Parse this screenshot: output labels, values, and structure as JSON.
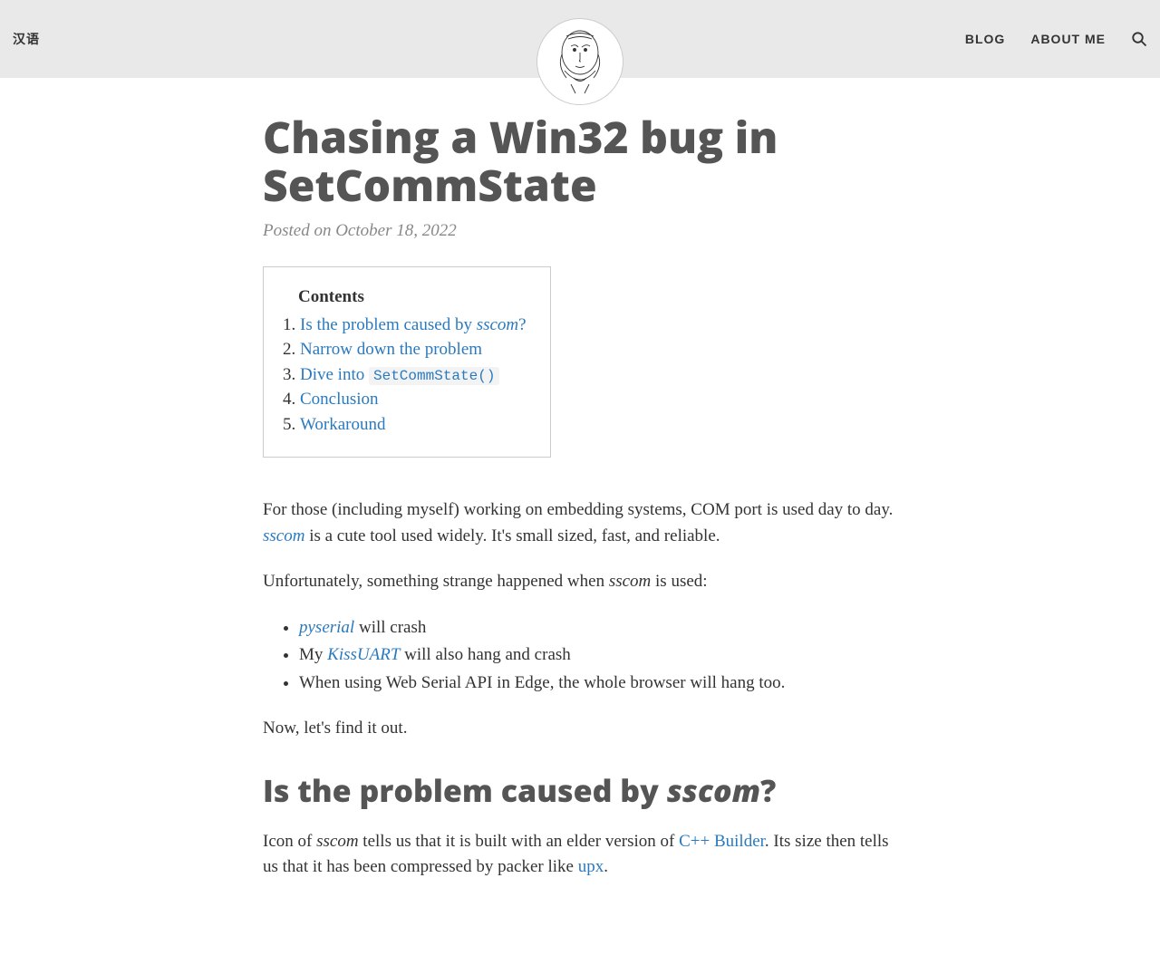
{
  "header": {
    "lang": "汉语",
    "nav": {
      "blog": "BLOG",
      "about": "ABOUT ME"
    }
  },
  "title": "Chasing a Win32 bug in SetCommState",
  "meta": "Posted on October 18, 2022",
  "toc": {
    "title": "Contents",
    "items": [
      {
        "text": "Is the problem caused by ",
        "em": "sscom",
        "tail": "?"
      },
      {
        "text": "Narrow down the problem"
      },
      {
        "text": "Dive into ",
        "code": "SetCommState()"
      },
      {
        "text": "Conclusion"
      },
      {
        "text": "Workaround"
      }
    ]
  },
  "p1": {
    "a": "For those (including myself) working on embedding systems, COM port is used day to day. ",
    "link": "sscom",
    "b": " is a cute tool used widely. It's small sized, fast, and reliable."
  },
  "p2": {
    "a": "Unfortunately, something strange happened when ",
    "em": "sscom",
    "b": " is used:"
  },
  "list": {
    "i1": {
      "link": "pyserial",
      "tail": " will crash"
    },
    "i2": {
      "a": "My ",
      "link": "KissUART",
      "tail": " will also hang and crash"
    },
    "i3": "When using Web Serial API in Edge, the whole browser will hang too."
  },
  "p3": "Now, let's find it out.",
  "h2": {
    "a": "Is the problem caused by ",
    "em": "sscom",
    "b": "?"
  },
  "p4": {
    "a": "Icon of ",
    "em": "sscom",
    "b": " tells us that it is built with an elder version of ",
    "link1": "C++ Builder",
    "c": ". Its size then tells us that it has been compressed by packer like ",
    "link2": "upx",
    "d": "."
  }
}
